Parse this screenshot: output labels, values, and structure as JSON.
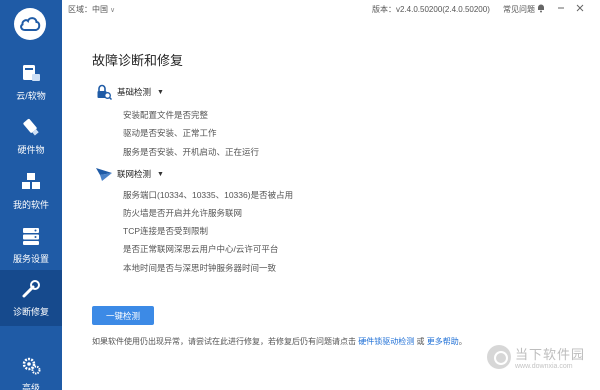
{
  "topbar": {
    "region_label": "区域：",
    "region_value": "中国",
    "version_label": "版本：",
    "version_value": "v2.4.0.50200(2.4.0.50200)",
    "faq_label": "常见问题"
  },
  "sidebar": {
    "items": [
      {
        "label": "云/软物",
        "icon": "cloud-device-icon"
      },
      {
        "label": "硬件物",
        "icon": "usb-key-icon"
      },
      {
        "label": "我的软件",
        "icon": "cubes-icon"
      },
      {
        "label": "服务设置",
        "icon": "server-icon"
      },
      {
        "label": "诊断修复",
        "icon": "wrench-icon"
      },
      {
        "label": "高级",
        "icon": "gears-icon"
      }
    ],
    "active_index": 4
  },
  "main": {
    "title": "故障诊断和修复",
    "sections": [
      {
        "title": "基础检测",
        "icon": "lock-search-icon",
        "items": [
          "安装配置文件是否完整",
          "驱动是否安装、正常工作",
          "服务是否安装、开机启动、正在运行"
        ]
      },
      {
        "title": "联网检测",
        "icon": "paper-plane-icon",
        "items": [
          "服务端口(10334、10335、10336)是否被占用",
          "防火墙是否开启并允许服务联网",
          "TCP连接是否受到限制",
          "是否正常联网深思云用户中心/云许可平台",
          "本地时间是否与深思时钟服务器时间一致"
        ]
      }
    ],
    "button_label": "一键检测",
    "footer": {
      "prefix": "如果软件使用仍出现异常，请尝试在此进行修复，若修复后仍有问题请点击",
      "link1": "硬件锁驱动检测",
      "middle": "或",
      "link2": "更多帮助",
      "suffix": "。"
    }
  },
  "watermark": {
    "cn": "当下软件园",
    "url": "www.downxia.com"
  },
  "colors": {
    "sidebar_bg": "#1f5ba6",
    "sidebar_active": "#164a8d",
    "button": "#3c8ae6",
    "link": "#1e6fd6"
  }
}
